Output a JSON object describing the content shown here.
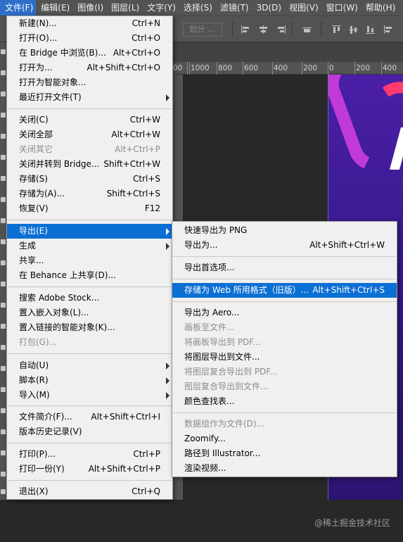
{
  "menubar": {
    "items": [
      "文件(F)",
      "编辑(E)",
      "图像(I)",
      "图层(L)",
      "文字(Y)",
      "选择(S)",
      "滤镜(T)",
      "3D(D)",
      "视图(V)",
      "窗口(W)",
      "帮助(H)"
    ]
  },
  "options_bar": {
    "distribute_label": "划分 ..."
  },
  "ruler": {
    "labels": [
      "00",
      "1000",
      "800",
      "600",
      "400",
      "200",
      "0",
      "200",
      "400"
    ]
  },
  "file_menu": {
    "items": [
      {
        "label": "新建(N)...",
        "shortcut": "Ctrl+N"
      },
      {
        "label": "打开(O)...",
        "shortcut": "Ctrl+O"
      },
      {
        "label": "在 Bridge 中浏览(B)...",
        "shortcut": "Alt+Ctrl+O"
      },
      {
        "label": "打开为...",
        "shortcut": "Alt+Shift+Ctrl+O"
      },
      {
        "label": "打开为智能对象...",
        "shortcut": ""
      },
      {
        "label": "最近打开文件(T)",
        "shortcut": ""
      },
      {
        "label": "关闭(C)",
        "shortcut": "Ctrl+W"
      },
      {
        "label": "关闭全部",
        "shortcut": "Alt+Ctrl+W"
      },
      {
        "label": "关闭其它",
        "shortcut": "Alt+Ctrl+P"
      },
      {
        "label": "关闭并转到 Bridge...",
        "shortcut": "Shift+Ctrl+W"
      },
      {
        "label": "存储(S)",
        "shortcut": "Ctrl+S"
      },
      {
        "label": "存储为(A)...",
        "shortcut": "Shift+Ctrl+S"
      },
      {
        "label": "恢复(V)",
        "shortcut": "F12"
      },
      {
        "label": "导出(E)",
        "shortcut": ""
      },
      {
        "label": "生成",
        "shortcut": ""
      },
      {
        "label": "共享...",
        "shortcut": ""
      },
      {
        "label": "在 Behance 上共享(D)...",
        "shortcut": ""
      },
      {
        "label": "搜索 Adobe Stock...",
        "shortcut": ""
      },
      {
        "label": "置入嵌入对象(L)...",
        "shortcut": ""
      },
      {
        "label": "置入链接的智能对象(K)...",
        "shortcut": ""
      },
      {
        "label": "打包(G)...",
        "shortcut": ""
      },
      {
        "label": "自动(U)",
        "shortcut": ""
      },
      {
        "label": "脚本(R)",
        "shortcut": ""
      },
      {
        "label": "导入(M)",
        "shortcut": ""
      },
      {
        "label": "文件简介(F)...",
        "shortcut": "Alt+Shift+Ctrl+I"
      },
      {
        "label": "版本历史记录(V)",
        "shortcut": ""
      },
      {
        "label": "打印(P)...",
        "shortcut": "Ctrl+P"
      },
      {
        "label": "打印一份(Y)",
        "shortcut": "Alt+Shift+Ctrl+P"
      },
      {
        "label": "退出(X)",
        "shortcut": "Ctrl+Q"
      }
    ]
  },
  "export_menu": {
    "items": [
      {
        "label": "快速导出为 PNG",
        "shortcut": ""
      },
      {
        "label": "导出为...",
        "shortcut": "Alt+Shift+Ctrl+W"
      },
      {
        "label": "导出首选项...",
        "shortcut": ""
      },
      {
        "label": "存储为 Web 所用格式（旧版）...",
        "shortcut": "Alt+Shift+Ctrl+S"
      },
      {
        "label": "导出为 Aero...",
        "shortcut": ""
      },
      {
        "label": "画板至文件...",
        "shortcut": ""
      },
      {
        "label": "将画板导出到 PDF...",
        "shortcut": ""
      },
      {
        "label": "将图层导出到文件...",
        "shortcut": ""
      },
      {
        "label": "将图层复合导出到 PDF...",
        "shortcut": ""
      },
      {
        "label": "图层复合导出到文件...",
        "shortcut": ""
      },
      {
        "label": "颜色查找表...",
        "shortcut": ""
      },
      {
        "label": "数据组作为文件(D)...",
        "shortcut": ""
      },
      {
        "label": "Zoomify...",
        "shortcut": ""
      },
      {
        "label": "路径到 Illustrator...",
        "shortcut": ""
      },
      {
        "label": "渲染视频...",
        "shortcut": ""
      }
    ]
  },
  "watermark": "@稀土掘金技术社区",
  "colors": {
    "menu_highlight": "#0b6fd3",
    "menubar_active": "#2f6fc9",
    "app_chrome": "#535353"
  }
}
